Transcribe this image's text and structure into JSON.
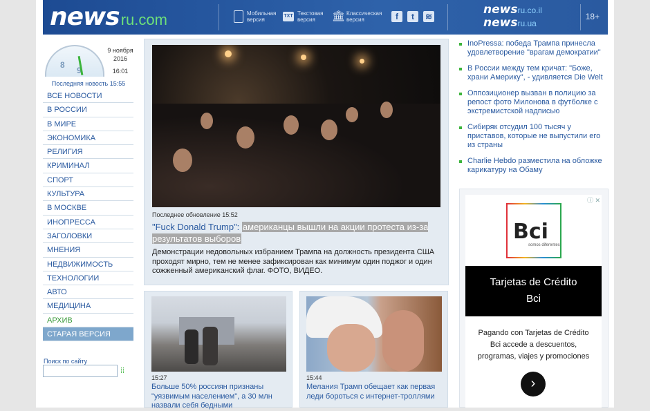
{
  "header": {
    "logo_news": "news",
    "logo_ru": "ru",
    "logo_com": ".com",
    "links": [
      {
        "label_1": "Мобильная",
        "label_2": "версия",
        "icon": "mobile-icon"
      },
      {
        "label_1": "Текстовая",
        "label_2": "версия",
        "icon": "text-version-icon",
        "icon_text": "TXT"
      },
      {
        "label_1": "Классическая",
        "label_2": "версия",
        "icon": "column-icon"
      }
    ],
    "social": [
      {
        "icon": "facebook-icon",
        "glyph": "f"
      },
      {
        "icon": "twitter-icon",
        "glyph": "t"
      },
      {
        "icon": "rss-icon",
        "glyph": "≋"
      }
    ],
    "mirror_1_news": "news",
    "mirror_1_domain": "ru.co.il",
    "mirror_2_news": "news",
    "mirror_2_domain": "ru.ua",
    "age": "18+",
    "colors": {
      "bar": "#2a5aa0",
      "accent": "#6ee07a"
    }
  },
  "sidebar": {
    "date": "9 ноября",
    "year": "2016",
    "time": "16:01",
    "last_news": "Последняя новость 15:55",
    "clock_numbers": [
      "8",
      "9"
    ],
    "nav": [
      {
        "label": "Все новости"
      },
      {
        "label": "В России"
      },
      {
        "label": "В мире"
      },
      {
        "label": "Экономика"
      },
      {
        "label": "Религия"
      },
      {
        "label": "Криминал"
      },
      {
        "label": "Спорт"
      },
      {
        "label": "Культура"
      },
      {
        "label": "В Москве"
      },
      {
        "label": "Инопресса"
      },
      {
        "label": "Заголовки"
      },
      {
        "label": "Мнения"
      },
      {
        "label": "Недвижимость"
      },
      {
        "label": "Технологии"
      },
      {
        "label": "Авто"
      },
      {
        "label": "Медицина"
      },
      {
        "label": "Архив"
      },
      {
        "label": "Старая версия"
      }
    ],
    "search_label": "Поиск по сайту"
  },
  "main": {
    "updated": "Последнее обновление 15:52",
    "headline_quote": "\"Fuck Donald Trump\":",
    "headline_rest": "американцы вышли на акции протеста из-за результатов выборов",
    "lead": "Демонстрации недовольных избранием Трампа на должность президента США проходят мирно, тем не менее зафиксирован как минимум один поджог и один сожженный американский флаг. ФОТО, ВИДЕО.",
    "sub": [
      {
        "time": "15:27",
        "title": "Больше 50% россиян признаны \"уязвимым населением\", а 30 млн назвали себя бедными"
      },
      {
        "time": "15:44",
        "title": "Мелания Трамп обещает как первая леди бороться с интернет-троллями"
      }
    ]
  },
  "right": {
    "news": [
      {
        "title": "InoPressa: победа Трампа принесла удовлетворение \"врагам демократии\""
      },
      {
        "title": "В России между тем кричат: \"Боже, храни Америку\", - удивляется Die Welt"
      },
      {
        "title": "Оппозиционер вызван в полицию за репост фото Милонова в футболке с экстремистской надписью"
      },
      {
        "title": "Сибиряк отсудил 100 тысяч у приставов, которые не выпустили его из страны"
      },
      {
        "title": "Charlie Hebdo разместила на обложке карикатуру на Обаму"
      }
    ],
    "ad": {
      "brand": "Bci",
      "brand_tagline": "somos diferentes",
      "title_1": "Tarjetas de Crédito",
      "title_2": "Bci",
      "text": "Pagando con Tarjetas de Crédito Bci accede a descuentos, programas, viajes y promociones",
      "adchoices": "ⓘ ✕"
    }
  }
}
